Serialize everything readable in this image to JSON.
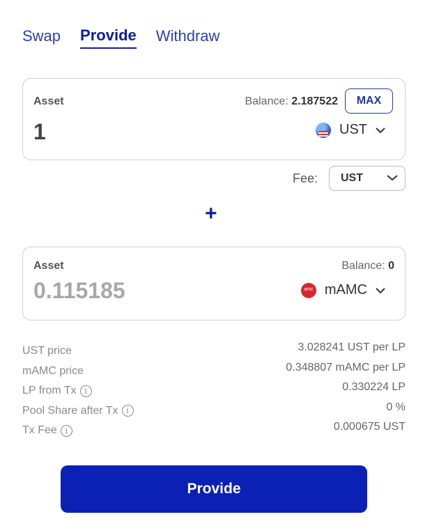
{
  "tabs": [
    {
      "label": "Swap",
      "active": false
    },
    {
      "label": "Provide",
      "active": true
    },
    {
      "label": "Withdraw",
      "active": false
    }
  ],
  "asset1": {
    "label": "Asset",
    "balance_label": "Balance:",
    "balance_value": "2.187522",
    "max_label": "MAX",
    "amount": "1",
    "token": "UST",
    "token_icon": "us-globe-icon"
  },
  "fee": {
    "label": "Fee:",
    "selected": "UST"
  },
  "plus_symbol": "+",
  "asset2": {
    "label": "Asset",
    "balance_label": "Balance:",
    "balance_value": "0",
    "amount": "0.115185",
    "token": "mAMC",
    "token_icon": "amc-icon"
  },
  "info": [
    {
      "label": "UST price",
      "value": "3.028241 UST per LP",
      "info_icon": false
    },
    {
      "label": "mAMC price",
      "value": "0.348807 mAMC per LP",
      "info_icon": false
    },
    {
      "label": "LP from Tx",
      "value": "0.330224 LP",
      "info_icon": true
    },
    {
      "label": "Pool Share after Tx",
      "value": "0 %",
      "info_icon": true
    },
    {
      "label": "Tx Fee",
      "value": "0.000675 UST",
      "info_icon": true
    }
  ],
  "submit_label": "Provide",
  "colors": {
    "primary": "#0b21b5",
    "tab_active": "#0b1f9c",
    "tab": "#2b3fb5"
  }
}
